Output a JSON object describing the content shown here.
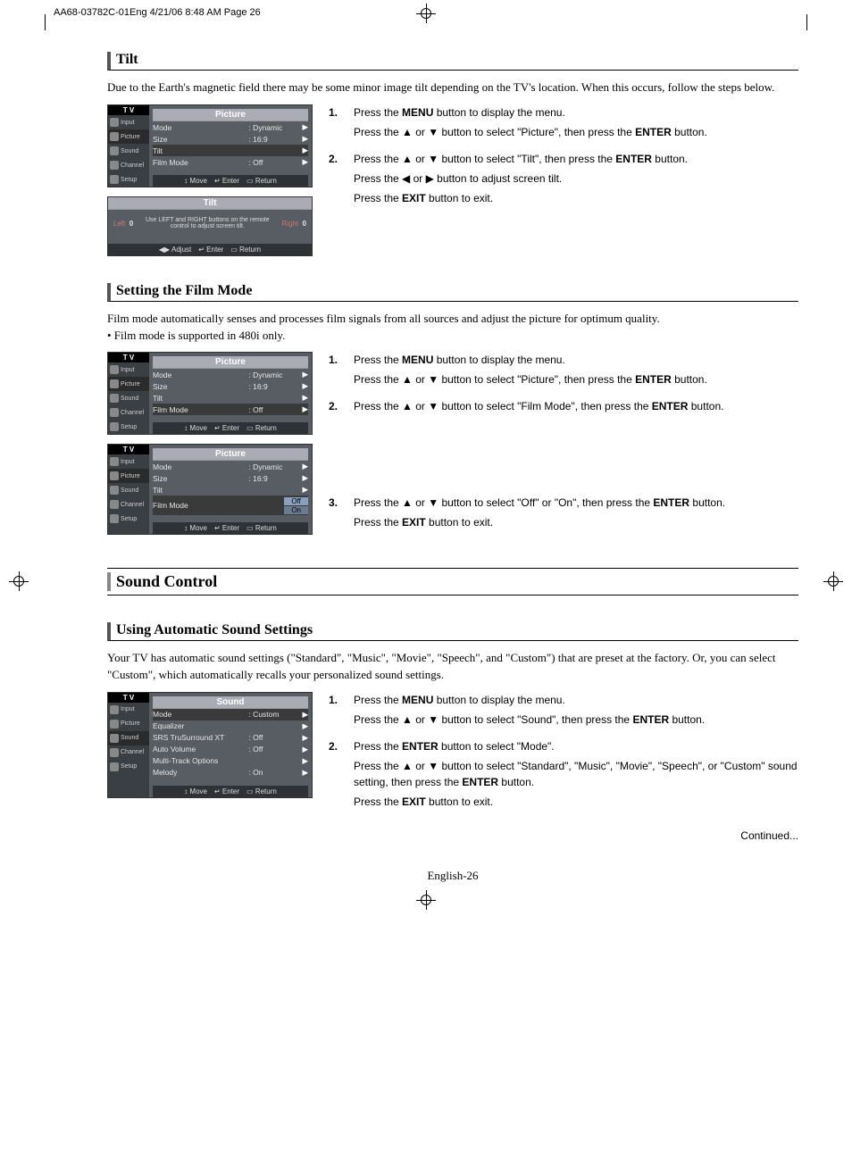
{
  "printHeader": "AA68-03782C-01Eng  4/21/06  8:48 AM  Page 26",
  "tilt": {
    "title": "Tilt",
    "desc": "Due to the Earth's magnetic field there may be some minor image tilt depending on the TV's location. When this occurs, follow the steps below.",
    "menu1": {
      "tv_label": "T V",
      "title": "Picture",
      "side": [
        "Input",
        "Picture",
        "Sound",
        "Channel",
        "Setup"
      ],
      "rows": [
        {
          "label": "Mode",
          "value": ": Dynamic"
        },
        {
          "label": "Size",
          "value": ": 16:9"
        },
        {
          "label": "Tilt",
          "value": "",
          "hl": true
        },
        {
          "label": "Film Mode",
          "value": ": Off"
        }
      ],
      "footer": {
        "move": "Move",
        "enter": "Enter",
        "return": "Return"
      }
    },
    "menu2": {
      "title": "Tilt",
      "left_label": "Left",
      "left_val": "0",
      "msg": "Use LEFT and RIGHT buttons on the remote control to adjust screen tilt.",
      "right_label": "Right",
      "right_val": "0",
      "footer": {
        "adjust": "Adjust",
        "enter": "Enter",
        "return": "Return"
      }
    },
    "steps": [
      {
        "num": "1.",
        "lines": [
          "Press the <b>MENU</b> button to display the menu.",
          "Press the ▲ or ▼ button to select \"Picture\", then press the <b>ENTER</b> button."
        ]
      },
      {
        "num": "2.",
        "lines": [
          "Press the ▲ or ▼ button to select \"Tilt\", then press the <b>ENTER</b> button.",
          "Press the ◀ or ▶ button to adjust screen tilt.",
          "Press the <b>EXIT</b> button to exit."
        ]
      }
    ]
  },
  "filmMode": {
    "title": "Setting the Film Mode",
    "desc": "Film mode automatically senses and processes film signals from all sources and adjust the picture for optimum quality.",
    "bullet": "•  Film mode is supported in 480i only.",
    "menu1": {
      "tv_label": "T V",
      "title": "Picture",
      "side": [
        "Input",
        "Picture",
        "Sound",
        "Channel",
        "Setup"
      ],
      "rows": [
        {
          "label": "Mode",
          "value": ": Dynamic"
        },
        {
          "label": "Size",
          "value": ": 16:9"
        },
        {
          "label": "Tilt",
          "value": ""
        },
        {
          "label": "Film Mode",
          "value": ": Off",
          "hl": true
        }
      ],
      "footer": {
        "move": "Move",
        "enter": "Enter",
        "return": "Return"
      }
    },
    "menu2": {
      "tv_label": "T V",
      "title": "Picture",
      "side": [
        "Input",
        "Picture",
        "Sound",
        "Channel",
        "Setup"
      ],
      "rows": [
        {
          "label": "Mode",
          "value": ": Dynamic"
        },
        {
          "label": "Size",
          "value": ": 16:9"
        },
        {
          "label": "Tilt",
          "value": ""
        },
        {
          "label": "Film Mode",
          "value": ":",
          "hl": true,
          "options": [
            "Off",
            "On"
          ]
        }
      ],
      "footer": {
        "move": "Move",
        "enter": "Enter",
        "return": "Return"
      }
    },
    "steps": [
      {
        "num": "1.",
        "lines": [
          "Press the <b>MENU</b> button to display the menu.",
          "Press the ▲ or ▼ button to select \"Picture\", then press the <b>ENTER</b> button."
        ]
      },
      {
        "num": "2.",
        "lines": [
          "Press the ▲ or ▼ button to select \"Film Mode\", then press the <b>ENTER</b> button."
        ]
      },
      {
        "num": "3.",
        "lines": [
          "Press the ▲ or ▼ button to select \"Off\" or \"On\", then press the <b>ENTER</b> button.",
          "Press the <b>EXIT</b> button to exit."
        ]
      }
    ]
  },
  "soundControl": {
    "major": "Sound Control",
    "title": "Using Automatic Sound Settings",
    "desc": "Your TV has automatic sound settings (\"Standard\", \"Music\", \"Movie\", \"Speech\", and \"Custom\") that are preset at the factory. Or, you can select \"Custom\", which automatically recalls your personalized sound settings.",
    "menu1": {
      "tv_label": "T V",
      "title": "Sound",
      "side": [
        "Input",
        "Picture",
        "Sound",
        "Channel",
        "Setup"
      ],
      "rows": [
        {
          "label": "Mode",
          "value": ": Custom",
          "hl": true
        },
        {
          "label": "Equalizer",
          "value": ""
        },
        {
          "label": "SRS TruSurround XT",
          "value": ": Off"
        },
        {
          "label": "Auto Volume",
          "value": ": Off"
        },
        {
          "label": "Multi-Track Options",
          "value": ""
        },
        {
          "label": "Melody",
          "value": ": On"
        }
      ],
      "footer": {
        "move": "Move",
        "enter": "Enter",
        "return": "Return"
      }
    },
    "steps": [
      {
        "num": "1.",
        "lines": [
          "Press the <b>MENU</b> button to display the menu.",
          "Press the ▲ or ▼ button to select \"Sound\", then press the <b>ENTER</b> button."
        ]
      },
      {
        "num": "2.",
        "lines": [
          "Press the <b>ENTER</b> button to select \"Mode\".",
          "Press the ▲ or ▼ button to select \"Standard\", \"Music\", \"Movie\", \"Speech\", or \"Custom\" sound setting, then press the <b>ENTER</b> button.",
          "Press the <b>EXIT</b> button to exit."
        ]
      }
    ]
  },
  "continued": "Continued...",
  "pageFooter": "English-26"
}
